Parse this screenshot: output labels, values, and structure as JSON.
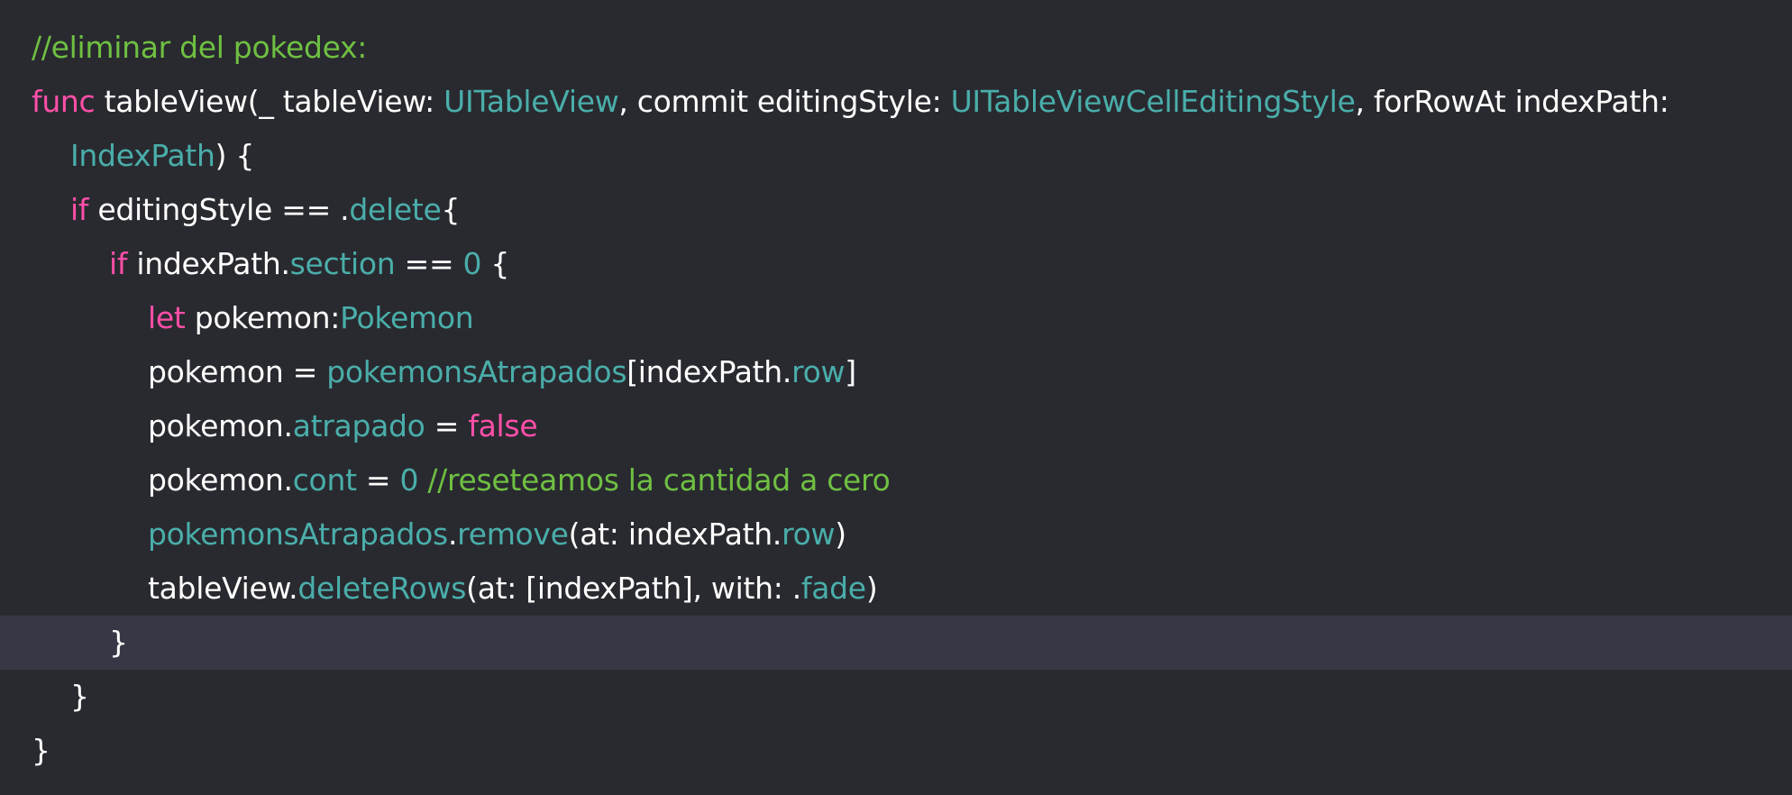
{
  "colors": {
    "background": "#292a30",
    "current_line": "#363845",
    "keyword": "#ff4fa8",
    "type": "#4aaeaa",
    "comment": "#6fc042",
    "plain": "#ffffff"
  },
  "editor": {
    "current_line_index": 11,
    "lines": [
      {
        "indent": 0,
        "tokens": [
          {
            "t": "//eliminar del pokedex:",
            "c": "comment"
          }
        ]
      },
      {
        "indent": 0,
        "tokens": [
          {
            "t": "func",
            "c": "kw"
          },
          {
            "t": " tableView(_ tableView: ",
            "c": "plain"
          },
          {
            "t": "UITableView",
            "c": "type"
          },
          {
            "t": ", commit editingStyle: ",
            "c": "plain"
          },
          {
            "t": "UITableViewCellEditingStyle",
            "c": "type"
          },
          {
            "t": ", forRowAt indexPath:",
            "c": "plain"
          }
        ]
      },
      {
        "indent": 1,
        "tokens": [
          {
            "t": "IndexPath",
            "c": "type"
          },
          {
            "t": ") {",
            "c": "plain"
          }
        ]
      },
      {
        "indent": 1,
        "tokens": [
          {
            "t": "if",
            "c": "kw"
          },
          {
            "t": " editingStyle == .",
            "c": "plain"
          },
          {
            "t": "delete",
            "c": "type"
          },
          {
            "t": "{",
            "c": "plain"
          }
        ]
      },
      {
        "indent": 2,
        "tokens": [
          {
            "t": "if",
            "c": "kw"
          },
          {
            "t": " indexPath.",
            "c": "plain"
          },
          {
            "t": "section",
            "c": "type"
          },
          {
            "t": " == ",
            "c": "plain"
          },
          {
            "t": "0",
            "c": "num"
          },
          {
            "t": " {",
            "c": "plain"
          }
        ]
      },
      {
        "indent": 3,
        "tokens": [
          {
            "t": "let",
            "c": "kw"
          },
          {
            "t": " pokemon:",
            "c": "plain"
          },
          {
            "t": "Pokemon",
            "c": "type"
          }
        ]
      },
      {
        "indent": 3,
        "tokens": [
          {
            "t": "pokemon = ",
            "c": "plain"
          },
          {
            "t": "pokemonsAtrapados",
            "c": "type"
          },
          {
            "t": "[indexPath.",
            "c": "plain"
          },
          {
            "t": "row",
            "c": "type"
          },
          {
            "t": "]",
            "c": "plain"
          }
        ]
      },
      {
        "indent": 3,
        "tokens": [
          {
            "t": "pokemon.",
            "c": "plain"
          },
          {
            "t": "atrapado",
            "c": "type"
          },
          {
            "t": " = ",
            "c": "plain"
          },
          {
            "t": "false",
            "c": "kw"
          }
        ]
      },
      {
        "indent": 3,
        "tokens": [
          {
            "t": "pokemon.",
            "c": "plain"
          },
          {
            "t": "cont",
            "c": "type"
          },
          {
            "t": " = ",
            "c": "plain"
          },
          {
            "t": "0",
            "c": "num"
          },
          {
            "t": " //reseteamos la cantidad a cero",
            "c": "comment"
          }
        ]
      },
      {
        "indent": 3,
        "tokens": [
          {
            "t": "pokemonsAtrapados",
            "c": "type"
          },
          {
            "t": ".",
            "c": "plain"
          },
          {
            "t": "remove",
            "c": "type"
          },
          {
            "t": "(at: indexPath.",
            "c": "plain"
          },
          {
            "t": "row",
            "c": "type"
          },
          {
            "t": ")",
            "c": "plain"
          }
        ]
      },
      {
        "indent": 3,
        "tokens": [
          {
            "t": "tableView.",
            "c": "plain"
          },
          {
            "t": "deleteRows",
            "c": "type"
          },
          {
            "t": "(at: [indexPath], with: .",
            "c": "plain"
          },
          {
            "t": "fade",
            "c": "type"
          },
          {
            "t": ")",
            "c": "plain"
          }
        ]
      },
      {
        "indent": 2,
        "tokens": [
          {
            "t": "}",
            "c": "plain"
          }
        ]
      },
      {
        "indent": 1,
        "tokens": [
          {
            "t": "}",
            "c": "plain"
          }
        ]
      },
      {
        "indent": 0,
        "tokens": [
          {
            "t": "}",
            "c": "plain"
          }
        ]
      }
    ]
  }
}
